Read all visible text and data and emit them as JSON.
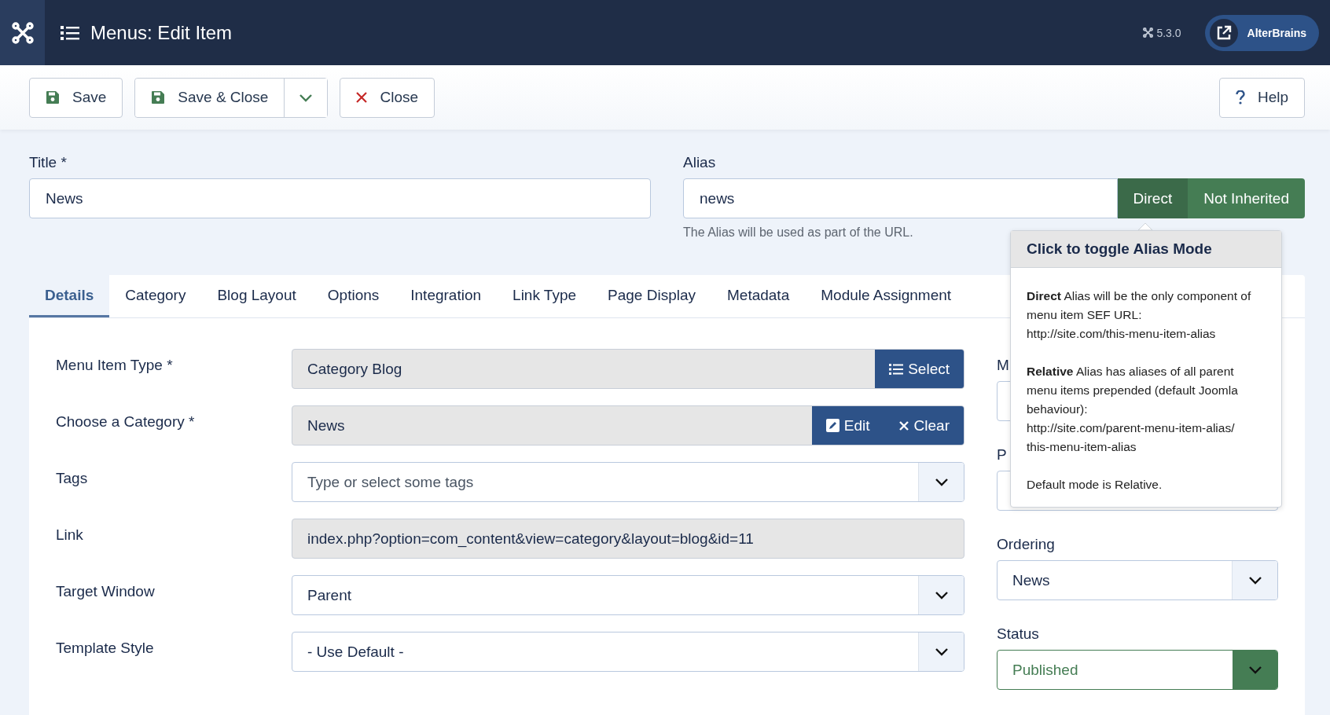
{
  "header": {
    "title": "Menus: Edit Item",
    "version": "5.3.0",
    "user_button": "AlterBrains"
  },
  "toolbar": {
    "buttons": [
      {
        "label": "Save",
        "kind": "save"
      },
      {
        "label": "Save & Close",
        "kind": "save-dropdown"
      },
      {
        "label": "Close",
        "kind": "close"
      }
    ],
    "help": "Help"
  },
  "title_field": {
    "label": "Title *",
    "value": "News"
  },
  "alias_field": {
    "label": "Alias",
    "value": "news",
    "hint": "The Alias will be used as part of the URL.",
    "toggles": [
      {
        "label": "Direct",
        "selected": true
      },
      {
        "label": "Not Inherited",
        "selected": false
      }
    ]
  },
  "tooltip": {
    "title": "Click to toggle Alias Mode",
    "paragraphs": [
      [
        "**Direct** Alias will be the only component of",
        "menu item SEF URL:",
        "http://site.com/this-menu-item-alias"
      ],
      [
        "**Relative** Alias has aliases of all parent",
        "menu items prepended (default Joomla",
        "behaviour):",
        "http://site.com/parent-menu-item-alias/",
        "this-menu-item-alias"
      ],
      [
        "Default mode is Relative."
      ]
    ]
  },
  "tabs": [
    {
      "label": "Details",
      "selected": true
    },
    {
      "label": "Category",
      "selected": false
    },
    {
      "label": "Blog Layout",
      "selected": false
    },
    {
      "label": "Options",
      "selected": false
    },
    {
      "label": "Integration",
      "selected": false
    },
    {
      "label": "Link Type",
      "selected": false
    },
    {
      "label": "Page Display",
      "selected": false
    },
    {
      "label": "Metadata",
      "selected": false
    },
    {
      "label": "Module Assignment",
      "selected": false
    }
  ],
  "fields": [
    {
      "label": "Menu Item Type *",
      "kind": "readonly",
      "value": "Category Blog",
      "actions": [
        {
          "label": "Select",
          "kind": "list"
        }
      ]
    },
    {
      "label": "Choose a Category *",
      "kind": "readonly",
      "value": "News",
      "actions": [
        {
          "label": "Edit",
          "kind": "edit"
        },
        {
          "label": "Clear",
          "kind": "clear"
        }
      ]
    },
    {
      "label": "Tags",
      "kind": "select",
      "placeholder": "Type or select some tags"
    },
    {
      "label": "Link",
      "kind": "readonly",
      "value": "index.php?option=com_content&view=category&layout=blog&id=11"
    },
    {
      "label": "Target Window",
      "kind": "select",
      "value": "Parent"
    },
    {
      "label": "Template Style",
      "kind": "select",
      "value": "- Use Default -"
    }
  ],
  "side_fields": [
    {
      "label": "M",
      "kind": "text"
    },
    {
      "label": "P",
      "kind": "text"
    },
    {
      "label": "Ordering",
      "kind": "select",
      "value": "News"
    },
    {
      "label": "Status",
      "kind": "status",
      "value": "Published"
    }
  ]
}
